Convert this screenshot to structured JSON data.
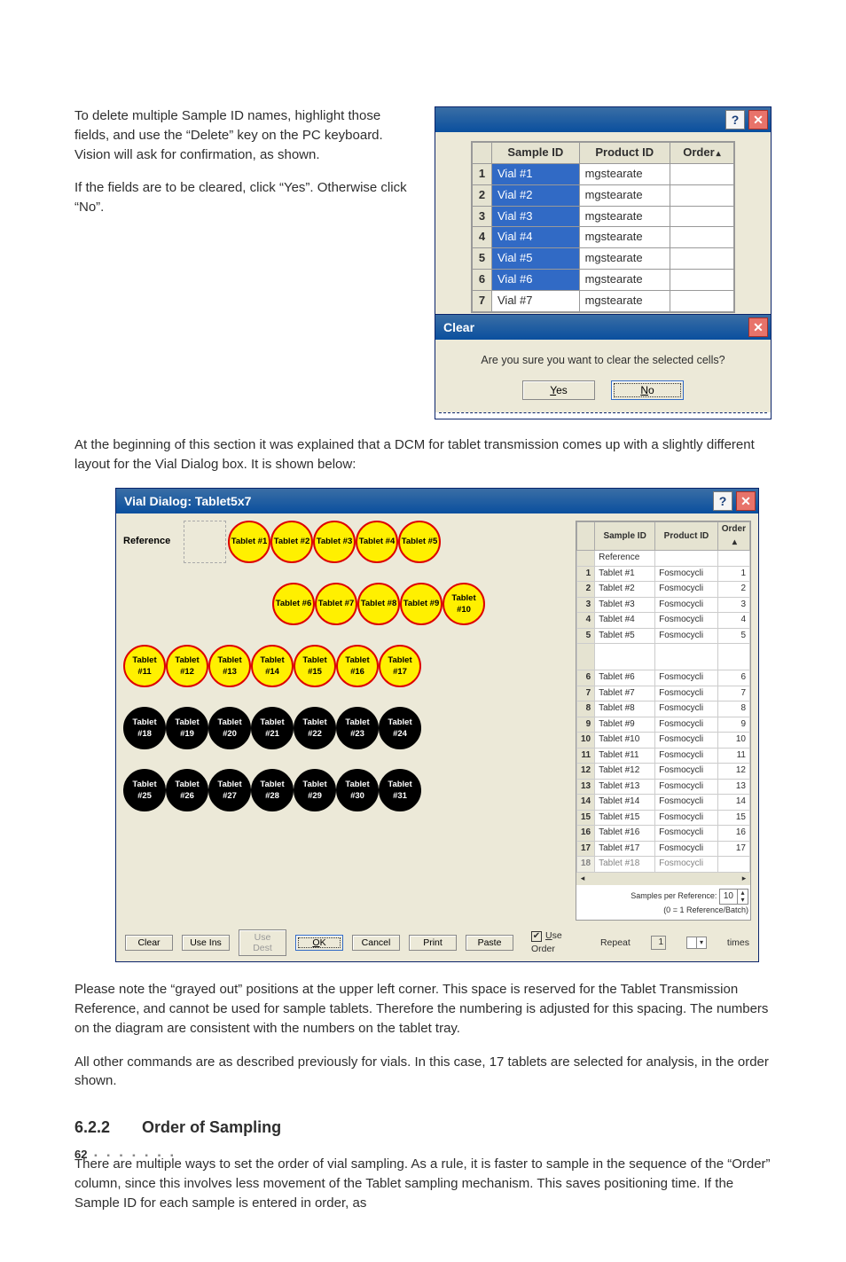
{
  "body": {
    "p1": "To delete multiple Sample ID names, highlight those fields, and use the “Delete” key on the PC keyboard. Vision will ask for confirmation, as shown.",
    "p2": "If the fields are to be cleared, click “Yes”. Otherwise click “No”.",
    "p3": "At the beginning of this section it was explained that a DCM for tablet transmission comes up with a slightly different layout for the Vial Dialog box. It is shown below:",
    "p4": "Please note the “grayed out” positions at the upper left corner. This space is reserved for the Tablet Transmission Reference, and cannot be used for sample tablets. Therefore the numbering is adjusted for this spacing. The numbers on the diagram are consistent with the numbers on the tablet tray.",
    "p5": "All other commands are as described previously for vials. In this case, 17 tablets are selected for analysis, in the order shown.",
    "section_num": "6.2.2",
    "section_title": "Order of Sampling",
    "p6": "There are multiple ways to set the order of vial sampling. As a rule, it is faster to sample in the sequence of the “Order” column, since this involves less movement of the Tablet sampling mechanism. This saves positioning time. If the Sample ID for each sample is entered in order, as"
  },
  "win1": {
    "help_glyph": "?",
    "close_glyph": "✕",
    "cols": {
      "sample": "Sample ID",
      "product": "Product ID",
      "order": "Order"
    },
    "sort_glyph": "▴",
    "rows": [
      {
        "n": "1",
        "sample": "Vial #1",
        "product": "mgstearate",
        "sel": true
      },
      {
        "n": "2",
        "sample": "Vial #2",
        "product": "mgstearate",
        "sel": true
      },
      {
        "n": "3",
        "sample": "Vial #3",
        "product": "mgstearate",
        "sel": true
      },
      {
        "n": "4",
        "sample": "Vial #4",
        "product": "mgstearate",
        "sel": true
      },
      {
        "n": "5",
        "sample": "Vial #5",
        "product": "mgstearate",
        "sel": true
      },
      {
        "n": "6",
        "sample": "Vial #6",
        "product": "mgstearate",
        "sel": true
      },
      {
        "n": "7",
        "sample": "Vial #7",
        "product": "mgstearate",
        "sel": false
      }
    ]
  },
  "msgbox": {
    "title": "Clear",
    "close_glyph": "✕",
    "text": "Are you sure you want to clear the selected cells?",
    "yes_u": "Y",
    "yes_r": "es",
    "no_u": "N",
    "no_r": "o"
  },
  "tabdlg": {
    "title": "Vial Dialog:  Tablet5x7",
    "help_glyph": "?",
    "close_glyph": "✕",
    "ref_label": "Reference",
    "rows": [
      {
        "ref": true,
        "labels": [
          "Tablet #1",
          "Tablet #2",
          "Tablet #3",
          "Tablet #4",
          "Tablet #5"
        ],
        "sel": true
      },
      {
        "labels": [
          "Tablet #6",
          "Tablet #7",
          "Tablet #8",
          "Tablet #9",
          "Tablet #10"
        ],
        "sel": true,
        "pad": 2
      },
      {
        "labels": [
          "Tablet #11",
          "Tablet #12",
          "Tablet #13",
          "Tablet #14",
          "Tablet #15",
          "Tablet #16",
          "Tablet #17"
        ],
        "sel": true
      },
      {
        "labels": [
          "Tablet #18",
          "Tablet #19",
          "Tablet #20",
          "Tablet #21",
          "Tablet #22",
          "Tablet #23",
          "Tablet #24"
        ],
        "sel": false
      },
      {
        "labels": [
          "Tablet #25",
          "Tablet #26",
          "Tablet #27",
          "Tablet #28",
          "Tablet #29",
          "Tablet #30",
          "Tablet #31"
        ],
        "sel": false
      }
    ],
    "grid_cols": {
      "sample": "Sample ID",
      "product": "Product ID",
      "order": "Order"
    },
    "sort_glyph": "▴",
    "ref_row_label": "Reference",
    "grid_rows": [
      {
        "n": "1",
        "sample": "Tablet #1",
        "product": "Fosmocycli",
        "order": "1"
      },
      {
        "n": "2",
        "sample": "Tablet #2",
        "product": "Fosmocycli",
        "order": "2"
      },
      {
        "n": "3",
        "sample": "Tablet #3",
        "product": "Fosmocycli",
        "order": "3"
      },
      {
        "n": "4",
        "sample": "Tablet #4",
        "product": "Fosmocycli",
        "order": "4"
      },
      {
        "n": "5",
        "sample": "Tablet #5",
        "product": "Fosmocycli",
        "order": "5"
      },
      {
        "n": "6",
        "sample": "Tablet #6",
        "product": "Fosmocycli",
        "order": "6",
        "gap": true
      },
      {
        "n": "7",
        "sample": "Tablet #7",
        "product": "Fosmocycli",
        "order": "7"
      },
      {
        "n": "8",
        "sample": "Tablet #8",
        "product": "Fosmocycli",
        "order": "8"
      },
      {
        "n": "9",
        "sample": "Tablet #9",
        "product": "Fosmocycli",
        "order": "9"
      },
      {
        "n": "10",
        "sample": "Tablet #10",
        "product": "Fosmocycli",
        "order": "10"
      },
      {
        "n": "11",
        "sample": "Tablet #11",
        "product": "Fosmocycli",
        "order": "11"
      },
      {
        "n": "12",
        "sample": "Tablet #12",
        "product": "Fosmocycli",
        "order": "12"
      },
      {
        "n": "13",
        "sample": "Tablet #13",
        "product": "Fosmocycli",
        "order": "13"
      },
      {
        "n": "14",
        "sample": "Tablet #14",
        "product": "Fosmocycli",
        "order": "14"
      },
      {
        "n": "15",
        "sample": "Tablet #15",
        "product": "Fosmocycli",
        "order": "15"
      },
      {
        "n": "16",
        "sample": "Tablet #16",
        "product": "Fosmocycli",
        "order": "16"
      },
      {
        "n": "17",
        "sample": "Tablet #17",
        "product": "Fosmocycli",
        "order": "17"
      }
    ],
    "trunc_row": {
      "n": "18",
      "sample": "Tablet #18",
      "product": "Fosmocycli"
    },
    "spr_label": "Samples per Reference:",
    "spr_sub": "(0 = 1 Reference/Batch)",
    "spr_value": "10",
    "btns": {
      "clear": "Clear",
      "useins": "Use Ins",
      "usedest": "Use Dest",
      "ok_u": "O",
      "ok_r": "K",
      "cancel": "Cancel",
      "print": "Print",
      "paste": "Paste"
    },
    "useorder_u": "U",
    "useorder_r": "se Order",
    "repeat": "Repeat",
    "repeat_val": "1",
    "times": "times"
  },
  "footer": {
    "pagenum": "62",
    "dots": "▪ ▪ ▪ ▪ ▪ ▪ ▪"
  }
}
